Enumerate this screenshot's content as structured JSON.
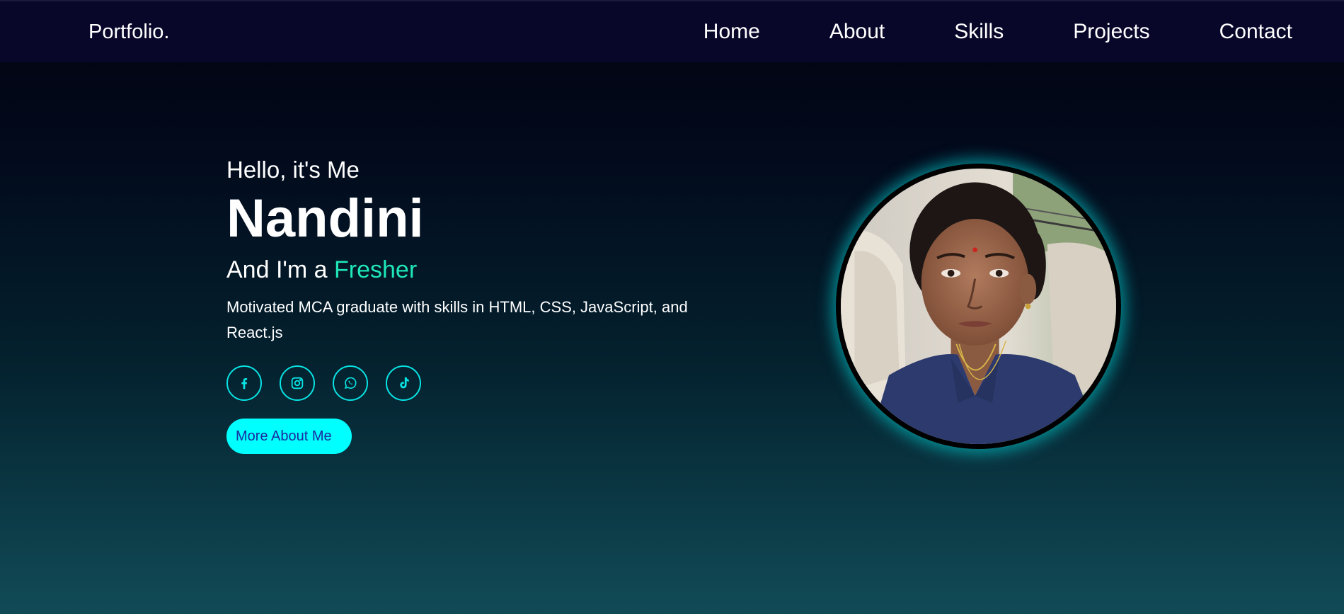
{
  "nav": {
    "logo": "Portfolio.",
    "links": [
      "Home",
      "About",
      "Skills",
      "Projects",
      "Contact"
    ]
  },
  "hero": {
    "greeting": "Hello, it's Me",
    "name": "Nandini",
    "role_prefix": "And I'm a ",
    "role": "Fresher",
    "description": "Motivated MCA graduate with skills in HTML, CSS, JavaScript, and React.js",
    "cta_label": "More About Me",
    "socials": [
      "facebook-icon",
      "instagram-icon",
      "whatsapp-icon",
      "tiktok-icon"
    ]
  },
  "colors": {
    "accent": "#1fe7b7",
    "cyan": "#00ffff",
    "nav_bg": "#08072a"
  }
}
